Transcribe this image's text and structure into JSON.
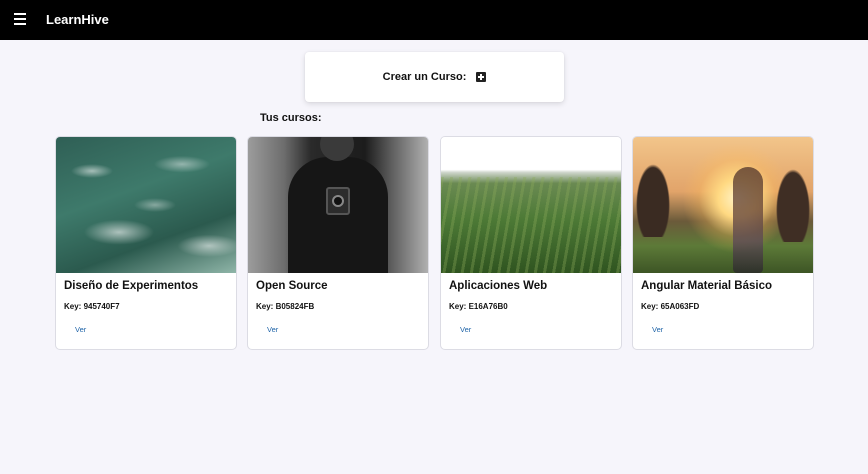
{
  "app": {
    "title": "LearnHive"
  },
  "create": {
    "label": "Crear un Curso:"
  },
  "section": {
    "title": "Tus cursos:"
  },
  "courses": [
    {
      "title": "Diseño de Experimentos",
      "key": "Key: 945740F7",
      "action": "Ver"
    },
    {
      "title": "Open Source",
      "key": "Key: B05824FB",
      "action": "Ver"
    },
    {
      "title": "Aplicaciones Web",
      "key": "Key: E16A76B0",
      "action": "Ver"
    },
    {
      "title": "Angular Material Básico",
      "key": "Key: 65A063FD",
      "action": "Ver"
    }
  ],
  "icons": {
    "menu": "menu-icon",
    "add": "add-box-icon"
  },
  "colors": {
    "topbar": "#000000",
    "background": "#f6f5fb",
    "link": "#1f64a8"
  }
}
